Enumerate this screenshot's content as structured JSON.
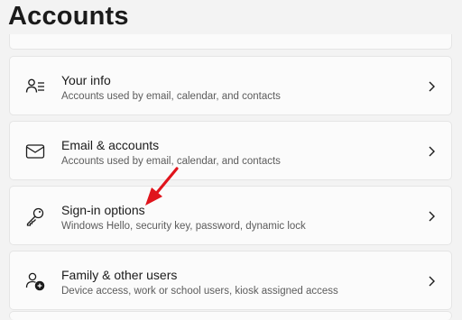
{
  "page": {
    "title": "Accounts"
  },
  "rows": [
    {
      "title": "Your info",
      "subtitle": "Accounts used by email, calendar, and contacts",
      "icon": "person-info-icon"
    },
    {
      "title": "Email & accounts",
      "subtitle": "Accounts used by email, calendar, and contacts",
      "icon": "mail-icon"
    },
    {
      "title": "Sign-in options",
      "subtitle": "Windows Hello, security key, password, dynamic lock",
      "icon": "key-icon"
    },
    {
      "title": "Family & other users",
      "subtitle": "Device access, work or school users, kiosk assigned access",
      "icon": "add-person-icon"
    }
  ],
  "colors": {
    "annotation_arrow": "#e0141c",
    "card_bg": "#fbfbfb",
    "page_bg": "#f3f3f3"
  }
}
